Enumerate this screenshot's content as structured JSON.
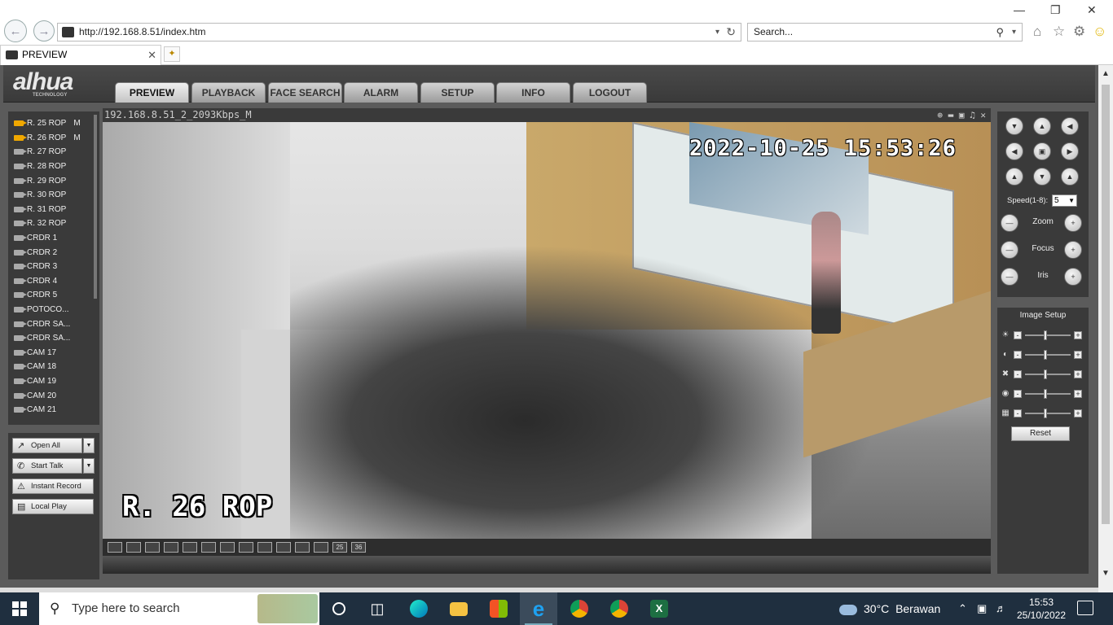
{
  "browser": {
    "url": "http://192.168.8.51/index.htm",
    "search_placeholder": "Search...",
    "tab_title": "PREVIEW"
  },
  "app": {
    "logo": "alhua",
    "logo_sub": "TECHNOLOGY",
    "menu": [
      "PREVIEW",
      "PLAYBACK",
      "FACE SEARCH",
      "ALARM",
      "SETUP",
      "INFO",
      "LOGOUT"
    ],
    "active_menu": "PREVIEW"
  },
  "channels": [
    {
      "label": "R. 25 ROP",
      "marker": "M",
      "active": true
    },
    {
      "label": "R. 26 ROP",
      "marker": "M",
      "active": true
    },
    {
      "label": "R. 27 ROP",
      "marker": "",
      "active": false
    },
    {
      "label": "R. 28 ROP",
      "marker": "",
      "active": false
    },
    {
      "label": "R. 29 ROP",
      "marker": "",
      "active": false
    },
    {
      "label": "R. 30 ROP",
      "marker": "",
      "active": false
    },
    {
      "label": "R. 31 ROP",
      "marker": "",
      "active": false
    },
    {
      "label": "R. 32 ROP",
      "marker": "",
      "active": false
    },
    {
      "label": "CRDR 1",
      "marker": "",
      "active": false
    },
    {
      "label": "CRDR 2",
      "marker": "",
      "active": false
    },
    {
      "label": "CRDR 3",
      "marker": "",
      "active": false
    },
    {
      "label": "CRDR 4",
      "marker": "",
      "active": false
    },
    {
      "label": "CRDR 5",
      "marker": "",
      "active": false
    },
    {
      "label": "POTOCO...",
      "marker": "",
      "active": false
    },
    {
      "label": "CRDR SA...",
      "marker": "",
      "active": false
    },
    {
      "label": "CRDR SA...",
      "marker": "",
      "active": false
    },
    {
      "label": "CAM 17",
      "marker": "",
      "active": false
    },
    {
      "label": "CAM 18",
      "marker": "",
      "active": false
    },
    {
      "label": "CAM 19",
      "marker": "",
      "active": false
    },
    {
      "label": "CAM 20",
      "marker": "",
      "active": false
    },
    {
      "label": "CAM 21",
      "marker": "",
      "active": false
    }
  ],
  "actions": {
    "open_all": "Open All",
    "start_talk": "Start Talk",
    "instant_record": "Instant Record",
    "local_play": "Local Play"
  },
  "video": {
    "stream_title": "192.168.8.51_2_2093Kbps_M",
    "timestamp": "2022-10-25 15:53:26",
    "camera_name": "R. 26 ROP",
    "layout_buttons": [
      "",
      "",
      "",
      "",
      "",
      "",
      "",
      "",
      "",
      "",
      "",
      "",
      "25",
      "36"
    ]
  },
  "ptz": {
    "speed_label": "Speed(1-8):",
    "speed_value": "5",
    "zoom": "Zoom",
    "focus": "Focus",
    "iris": "Iris"
  },
  "image_setup": {
    "title": "Image Setup",
    "reset": "Reset"
  },
  "taskbar": {
    "search_placeholder": "Type here to search",
    "weather_temp": "30°C",
    "weather_text": "Berawan",
    "time": "15:53",
    "date": "25/10/2022"
  }
}
